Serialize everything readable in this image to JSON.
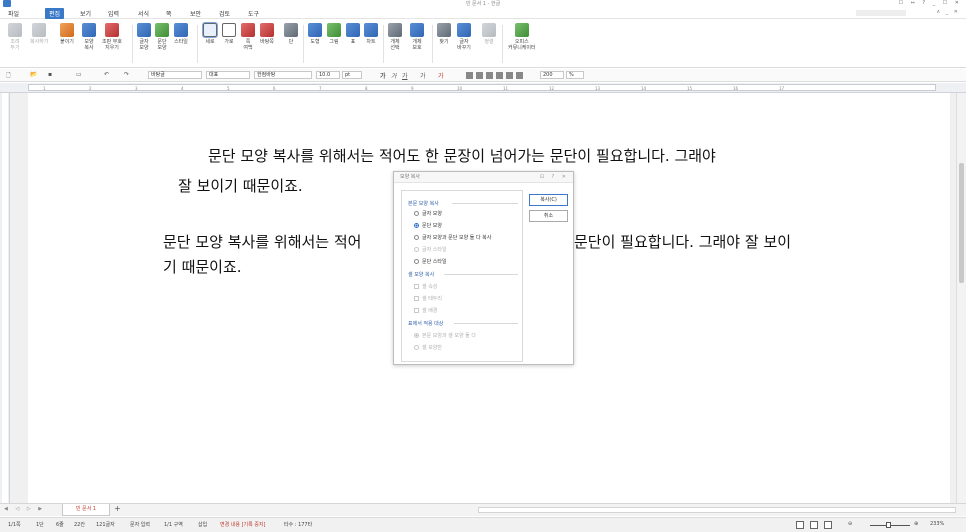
{
  "window": {
    "title": "빈 문서 1 - 한글",
    "controls": "☐ ⇔ ? _ ☐ ✕"
  },
  "menu": {
    "items": [
      "파일",
      "편집",
      "보기",
      "입력",
      "서식",
      "쪽",
      "보안",
      "검토",
      "도구"
    ],
    "active": "편집",
    "right_controls": "∧ _ ✕"
  },
  "ribbon": {
    "buttons": [
      {
        "label1": "조려",
        "label2": "두기",
        "icon": "scissors-icon",
        "disabled": true
      },
      {
        "label1": "복사하기",
        "label2": "",
        "icon": "copy-icon",
        "disabled": true
      },
      {
        "label1": "붙이기",
        "label2": "",
        "icon": "paste-icon",
        "disabled": false
      },
      {
        "label1": "모양",
        "label2": "복사",
        "icon": "format-painter-icon",
        "disabled": false
      },
      {
        "label1": "조판 부호",
        "label2": "지우기",
        "icon": "clear-code-icon",
        "disabled": false
      },
      {
        "label1": "글자",
        "label2": "모양",
        "icon": "char-shape-icon",
        "disabled": false
      },
      {
        "label1": "문단",
        "label2": "모양",
        "icon": "para-shape-icon",
        "disabled": false
      },
      {
        "label1": "스타일",
        "label2": "",
        "icon": "style-icon",
        "disabled": false
      },
      {
        "label1": "세로",
        "label2": "",
        "icon": "portrait-icon",
        "disabled": false,
        "selected": true
      },
      {
        "label1": "가로",
        "label2": "",
        "icon": "landscape-icon",
        "disabled": false
      },
      {
        "label1": "쪽",
        "label2": "여백",
        "icon": "margin-icon",
        "disabled": false
      },
      {
        "label1": "바탕쪽",
        "label2": "",
        "icon": "master-page-icon",
        "disabled": false
      },
      {
        "label1": "단",
        "label2": "",
        "icon": "column-icon",
        "disabled": false
      },
      {
        "label1": "도형",
        "label2": "",
        "icon": "shape-icon",
        "disabled": false
      },
      {
        "label1": "그림",
        "label2": "",
        "icon": "picture-icon",
        "disabled": false
      },
      {
        "label1": "표",
        "label2": "",
        "icon": "table-icon",
        "disabled": false
      },
      {
        "label1": "차트",
        "label2": "",
        "icon": "chart-icon",
        "disabled": false
      },
      {
        "label1": "개체",
        "label2": "선택",
        "icon": "object-select-icon",
        "disabled": false
      },
      {
        "label1": "개체",
        "label2": "보호",
        "icon": "object-protect-icon",
        "disabled": false
      },
      {
        "label1": "찾기",
        "label2": "",
        "icon": "find-icon",
        "disabled": false
      },
      {
        "label1": "글자",
        "label2": "바꾸기",
        "icon": "replace-icon",
        "disabled": false
      },
      {
        "label1": "정렬",
        "label2": "",
        "icon": "sort-icon",
        "disabled": true
      },
      {
        "label1": "오피스",
        "label2": "커뮤니케이터",
        "icon": "office-communicator-icon",
        "disabled": false
      }
    ]
  },
  "format": {
    "style": "바탕글",
    "lang": "대표",
    "font": "한컴바탕",
    "size": "10.0",
    "unit": "pt",
    "zoom": "200",
    "zoom_unit": "%"
  },
  "ruler": {
    "ticks": [
      "1",
      "2",
      "3",
      "4",
      "5",
      "6",
      "7",
      "8",
      "9",
      "10",
      "11",
      "12",
      "13",
      "14",
      "15",
      "16",
      "17"
    ]
  },
  "document": {
    "para1_line1": "문단 모양 복사를 위해서는 적어도 한 문장이 넘어가는 문단이 필요합니다. 그래야",
    "para1_line2": "잘 보이기 때문이죠.",
    "para2_line1a": "문단 모양 복사를 위해서는 적어",
    "para2_line1b": "문단이 필요합니다. 그래야 잘 보이",
    "para2_line2": "기 때문이죠."
  },
  "dialog": {
    "title": "모양 복사",
    "controls": "⊡ ? ✕",
    "group1": "본문 모양 복사",
    "opt_char": "글자 모양",
    "opt_para": "문단 모양",
    "opt_both": "글자 모양과 문단 모양 둘 다 복사",
    "opt_charstyle": "글자 스타일",
    "opt_parastyle": "문단 스타일",
    "group2": "셀 모양 복사",
    "opt_cellattr": "셀 속성",
    "opt_cellborder": "셀 테두리",
    "opt_cellbg": "셀 배경",
    "group3": "표에서 적용 대상",
    "opt_both_apply": "본문 모양과 셀 모양 둘 다",
    "opt_cellonly": "셀 모양만",
    "copy_button": "복사(C)",
    "cancel_button": "취소"
  },
  "tabs": {
    "doc_tab": "빈 문서 1",
    "nav": "◀ ◁ ▷ ▶"
  },
  "status": {
    "page": "1/1쪽",
    "section": "1단",
    "line": "6줄",
    "col": "22칸",
    "chars": "121글자",
    "mode": "문자 입력",
    "zone": "1/1 구역",
    "insert": "삽입",
    "track": "변경 내용 [기록 중지]",
    "typing": "타수 : 177타",
    "zoom": "233%"
  },
  "colors": {
    "accent": "#3a78c8",
    "tab_text": "#c0392b"
  }
}
